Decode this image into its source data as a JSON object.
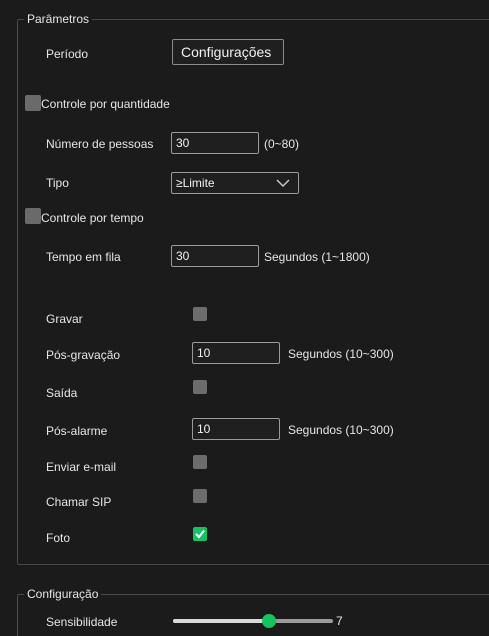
{
  "parametros": {
    "title": "Parâmetros",
    "periodo": {
      "label": "Período",
      "button": "Configurações"
    },
    "controle_quantidade": {
      "label": "Controle por quantidade",
      "checked": false
    },
    "numero_pessoas": {
      "label": "Número de pessoas",
      "value": "30",
      "range": "(0~80)"
    },
    "tipo": {
      "label": "Tipo",
      "value": "≥Limite"
    },
    "controle_tempo": {
      "label": "Controle por tempo",
      "checked": false
    },
    "tempo_fila": {
      "label": "Tempo em fila",
      "value": "30",
      "unit": "Segundos (1~1800)"
    },
    "gravar": {
      "label": "Gravar",
      "checked": false
    },
    "pos_gravacao": {
      "label": "Pós-gravação",
      "value": "10",
      "unit": "Segundos (10~300)"
    },
    "saida": {
      "label": "Saída",
      "checked": false
    },
    "pos_alarme": {
      "label": "Pós-alarme",
      "value": "10",
      "unit": "Segundos (10~300)"
    },
    "enviar_email": {
      "label": "Enviar e-mail",
      "checked": false
    },
    "chamar_sip": {
      "label": "Chamar SIP",
      "checked": false
    },
    "foto": {
      "label": "Foto",
      "checked": true
    }
  },
  "configuracao": {
    "title": "Configuração",
    "sensibilidade": {
      "label": "Sensibilidade",
      "value": "7",
      "level": 0.6
    }
  },
  "colors": {
    "background": "#1b1b1b",
    "accent_green": "#17c35e",
    "checkbox_gray": "#6d6d6d",
    "border": "#9a9a9a"
  },
  "icons": {
    "chevron": "chevron-down-icon",
    "check": "checkmark-icon"
  }
}
